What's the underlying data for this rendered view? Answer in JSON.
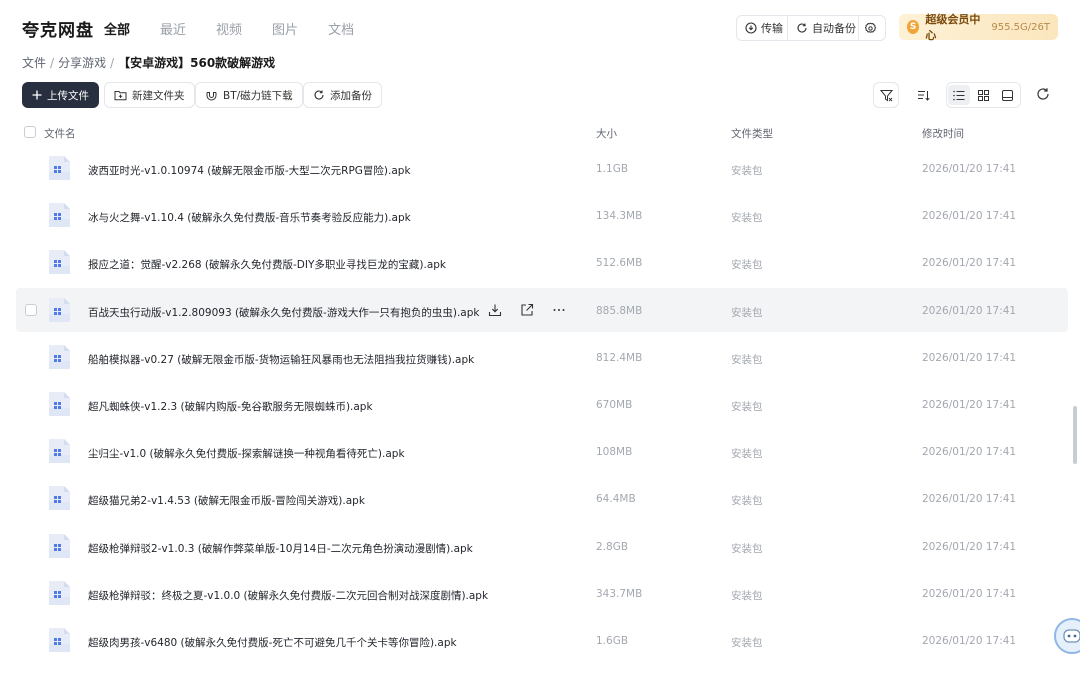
{
  "app": {
    "logo": "夸克网盘",
    "nav": [
      "全部",
      "最近",
      "视频",
      "图片",
      "文档"
    ],
    "nav_active": 0,
    "transfer_label": "传输",
    "backup_label": "自动备份",
    "vip_badge": "S",
    "vip_label": "超级会员中心",
    "vip_storage": "955.5G/26T"
  },
  "breadcrumb": {
    "items": [
      "文件",
      "分享游戏"
    ],
    "current": "【安卓游戏】560款破解游戏"
  },
  "toolbar": {
    "upload": "上传文件",
    "new_folder": "新建文件夹",
    "bt_download": "BT/磁力链下载",
    "add_backup": "添加备份"
  },
  "table": {
    "headers": {
      "name": "文件名",
      "size": "大小",
      "type": "文件类型",
      "modified": "修改时间"
    },
    "rows": [
      {
        "name": "波西亚时光-v1.0.10974 (破解无限金币版-大型二次元RPG冒险).apk",
        "size": "1.1GB",
        "type": "安装包",
        "modified": "2026/01/20 17:41"
      },
      {
        "name": "冰与火之舞-v1.10.4 (破解永久免付费版-音乐节奏考验反应能力).apk",
        "size": "134.3MB",
        "type": "安装包",
        "modified": "2026/01/20 17:41"
      },
      {
        "name": "报应之道：觉醒-v2.268 (破解永久免付费版-DIY多职业寻找巨龙的宝藏).apk",
        "size": "512.6MB",
        "type": "安装包",
        "modified": "2026/01/20 17:41"
      },
      {
        "name": "百战天虫行动版-v1.2.809093 (破解永久免付费版-游戏大作一只有抱负的虫虫).apk",
        "size": "885.8MB",
        "type": "安装包",
        "modified": "2026/01/20 17:41"
      },
      {
        "name": "船舶模拟器-v0.27 (破解无限金币版-货物运输狂风暴雨也无法阻挡我拉货赚钱).apk",
        "size": "812.4MB",
        "type": "安装包",
        "modified": "2026/01/20 17:41"
      },
      {
        "name": "超凡蜘蛛侠-v1.2.3 (破解内购版-免谷歌服务无限蜘蛛币).apk",
        "size": "670MB",
        "type": "安装包",
        "modified": "2026/01/20 17:41"
      },
      {
        "name": "尘归尘-v1.0 (破解永久免付费版-探索解谜换一种视角看待死亡).apk",
        "size": "108MB",
        "type": "安装包",
        "modified": "2026/01/20 17:41"
      },
      {
        "name": "超级猫兄弟2-v1.4.53 (破解无限金币版-冒险闯关游戏).apk",
        "size": "64.4MB",
        "type": "安装包",
        "modified": "2026/01/20 17:41"
      },
      {
        "name": "超级枪弹辩驳2-v1.0.3 (破解作弊菜单版-10月14日-二次元角色扮演动漫剧情).apk",
        "size": "2.8GB",
        "type": "安装包",
        "modified": "2026/01/20 17:41"
      },
      {
        "name": "超级枪弹辩驳：终极之夏-v1.0.0 (破解永久免付费版-二次元回合制对战深度剧情).apk",
        "size": "343.7MB",
        "type": "安装包",
        "modified": "2026/01/20 17:41"
      },
      {
        "name": "超级肉男孩-v6480 (破解永久免付费版-死亡不可避免几千个关卡等你冒险).apk",
        "size": "1.6GB",
        "type": "安装包",
        "modified": "2026/01/20 17:41"
      }
    ],
    "hovered_row": 3
  }
}
